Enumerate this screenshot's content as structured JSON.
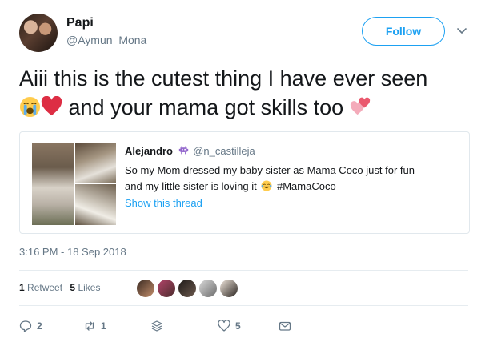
{
  "header": {
    "name": "Papi",
    "handle": "@Aymun_Mona",
    "follow_label": "Follow"
  },
  "tweet": {
    "line1": "Aiii this is the cutest thing I have ever seen",
    "line2": "and your mama got skills too",
    "emojis": [
      "loudly-crying-face",
      "red-heart",
      "revolving-hearts"
    ]
  },
  "quote": {
    "name": "Alejandro",
    "handle": "@n_castilleja",
    "text_line1": "So my Mom dressed my baby sister as Mama Coco just for fun",
    "text_line2": "and my little sister is loving it",
    "hashtag": "#MamaCoco",
    "show_thread": "Show this thread",
    "name_emoji": "alien-monster"
  },
  "timestamp": "3:16 PM - 18 Sep 2018",
  "stats": {
    "retweets_count": "1",
    "retweets_label": "Retweet",
    "likes_count": "5",
    "likes_label": "Likes"
  },
  "actions": {
    "reply_count": "2",
    "retweet_count": "1",
    "like_count": "5"
  },
  "colors": {
    "accent": "#1da1f2",
    "muted": "#657786",
    "text": "#14171a"
  }
}
